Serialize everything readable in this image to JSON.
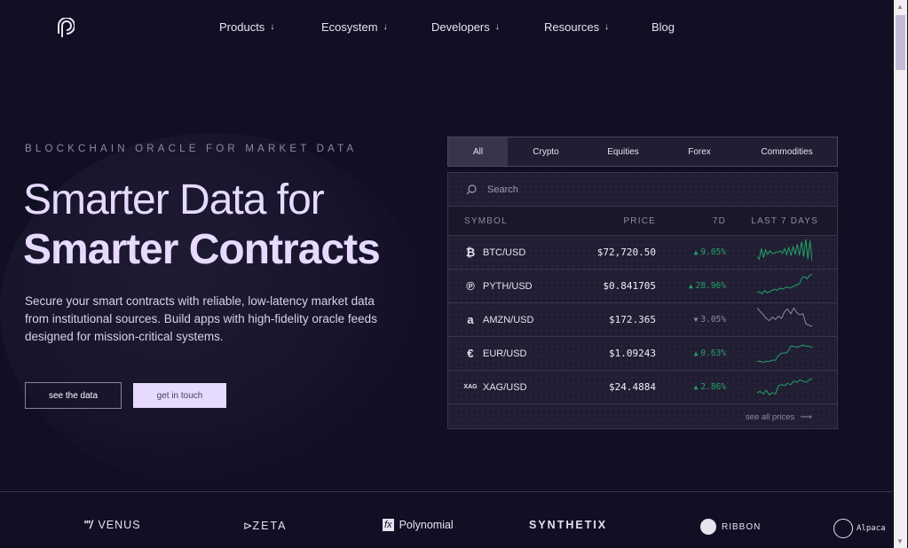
{
  "nav": {
    "items": [
      {
        "label": "Products",
        "dropdown": true
      },
      {
        "label": "Ecosystem",
        "dropdown": true
      },
      {
        "label": "Developers",
        "dropdown": true
      },
      {
        "label": "Resources",
        "dropdown": true
      },
      {
        "label": "Blog",
        "dropdown": false
      }
    ]
  },
  "hero": {
    "eyebrow": "BLOCKCHAIN ORACLE FOR MARKET DATA",
    "title_line1": "Smarter Data for",
    "title_line2": "Smarter Contracts",
    "description": "Secure your smart contracts with reliable, low-latency market data from institutional sources. Build apps with high-fidelity oracle feeds designed for mission-critical systems.",
    "primary_button": "see the data",
    "secondary_button": "get in touch"
  },
  "prices": {
    "tabs": [
      "All",
      "Crypto",
      "Equities",
      "Forex",
      "Commodities"
    ],
    "active_tab": "All",
    "search_placeholder": "Search",
    "columns": [
      "SYMBOL",
      "PRICE",
      "7D",
      "LAST 7 DAYS"
    ],
    "rows": [
      {
        "icon": "bitcoin-icon",
        "icon_glyph": "₿",
        "symbol": "BTC/USD",
        "price": "$72,720.50",
        "change": "9.05%",
        "direction": "up"
      },
      {
        "icon": "pyth-icon",
        "icon_glyph": "℗",
        "symbol": "PYTH/USD",
        "price": "$0.841705",
        "change": "28.96%",
        "direction": "up"
      },
      {
        "icon": "amazon-icon",
        "icon_glyph": "a",
        "symbol": "AMZN/USD",
        "price": "$172.365",
        "change": "3.05%",
        "direction": "down"
      },
      {
        "icon": "euro-icon",
        "icon_glyph": "€",
        "symbol": "EUR/USD",
        "price": "$1.09243",
        "change": "0.63%",
        "direction": "up"
      },
      {
        "icon": "silver-icon",
        "icon_glyph": "XAG",
        "symbol": "XAG/USD",
        "price": "$24.4884",
        "change": "2.86%",
        "direction": "up"
      }
    ],
    "see_all": "see all prices"
  },
  "colors": {
    "up": "#21a366",
    "down": "#8f8aa4",
    "accent": "#e6dafe",
    "background": "#110f23"
  },
  "partners": [
    "VENUS",
    "ZETA",
    "Polynomial",
    "SYNTHETIX",
    "RIBBON",
    "Alpaca"
  ]
}
